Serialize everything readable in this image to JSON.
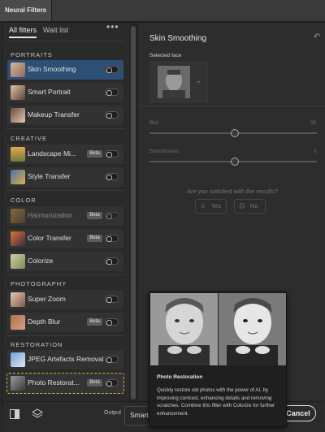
{
  "window": {
    "title": "Neural Filters"
  },
  "tabs": {
    "all": "All filters",
    "wait": "Wait list",
    "more": "•••"
  },
  "categories": {
    "portraits": "PORTRAITS",
    "creative": "CREATIVE",
    "color": "COLOR",
    "photography": "PHOTOGRAPHY",
    "restoration": "RESTORATION"
  },
  "filters": [
    {
      "label": "Skin Smoothing"
    },
    {
      "label": "Smart Portrait"
    },
    {
      "label": "Makeup Transfer"
    },
    {
      "label": "Landscape Mi...",
      "beta": "Beta"
    },
    {
      "label": "Style Transfer"
    },
    {
      "label": "Harmonization",
      "beta": "Beta"
    },
    {
      "label": "Color Transfer",
      "beta": "Beta"
    },
    {
      "label": "Colorize"
    },
    {
      "label": "Super Zoom"
    },
    {
      "label": "Depth Blur",
      "beta": "Beta"
    },
    {
      "label": "JPEG Artefacts Removal"
    },
    {
      "label": "Photo Restorat...",
      "beta": "Beta"
    }
  ],
  "panel": {
    "title": "Skin Smoothing",
    "selected_face_label": "Selected face",
    "blur_label": "Blur",
    "blur_value": "50",
    "smoothness_label": "Smoothness",
    "smoothness_value": "0",
    "question": "Are you satisfied with the results?",
    "yes": "Yes",
    "no": "No"
  },
  "bottom": {
    "output_label": "Output",
    "output_value": "Smart",
    "cancel": "Cancel"
  },
  "popup": {
    "title": "Photo Restoration",
    "description": "Quickly restore old photos with the power of AI, by improving contrast, enhancing details and removing scratches. Combine this filter with Colorize for further enhancement."
  }
}
